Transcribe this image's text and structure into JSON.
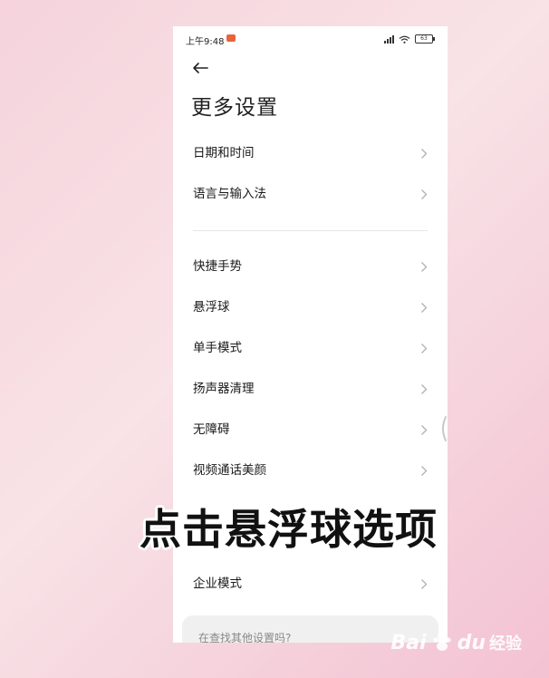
{
  "status_bar": {
    "time": "上午9:48",
    "battery": "63"
  },
  "header": {
    "title": "更多设置"
  },
  "menu_group_1": [
    {
      "label": "日期和时间"
    },
    {
      "label": "语言与输入法"
    }
  ],
  "menu_group_2": [
    {
      "label": "快捷手势"
    },
    {
      "label": "悬浮球"
    },
    {
      "label": "单手模式"
    },
    {
      "label": "扬声器清理"
    },
    {
      "label": "无障碍"
    },
    {
      "label": "视频通话美颜"
    }
  ],
  "menu_group_3": [
    {
      "label": "企业模式"
    }
  ],
  "search_card": {
    "text": "在查找其他设置吗?"
  },
  "overlay": {
    "caption": "点击悬浮球选项"
  },
  "watermark": {
    "bai": "Bai",
    "du": "du",
    "jingyan": "经验"
  }
}
